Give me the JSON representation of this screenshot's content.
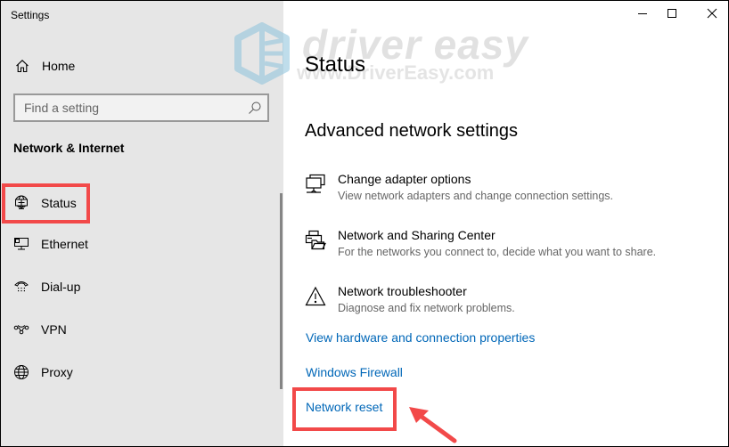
{
  "window": {
    "title": "Settings",
    "controls": {
      "minimize": "minimize-icon",
      "maximize": "maximize-icon",
      "close": "close-icon"
    }
  },
  "sidebar": {
    "home_label": "Home",
    "search": {
      "placeholder": "Find a setting",
      "value": ""
    },
    "section_heading": "Network & Internet",
    "items": [
      {
        "label": "Status",
        "icon": "globe-monitor-icon",
        "highlighted": true
      },
      {
        "label": "Ethernet",
        "icon": "ethernet-icon",
        "highlighted": false
      },
      {
        "label": "Dial-up",
        "icon": "dial-up-phone-icon",
        "highlighted": false
      },
      {
        "label": "VPN",
        "icon": "vpn-icon",
        "highlighted": false
      },
      {
        "label": "Proxy",
        "icon": "globe-icon",
        "highlighted": false
      }
    ]
  },
  "main": {
    "title": "Status",
    "subtitle": "Advanced network settings",
    "options": [
      {
        "title": "Change adapter options",
        "description": "View network adapters and change connection settings.",
        "icon": "network-adapter-icon"
      },
      {
        "title": "Network and Sharing Center",
        "description": "For the networks you connect to, decide what you want to share.",
        "icon": "sharing-center-icon"
      },
      {
        "title": "Network troubleshooter",
        "description": "Diagnose and fix network problems.",
        "icon": "warning-icon"
      }
    ],
    "links": [
      {
        "label": "View hardware and connection properties"
      },
      {
        "label": "Windows Firewall"
      },
      {
        "label": "Network reset",
        "highlighted": true
      }
    ]
  },
  "watermark": {
    "brand": "driver easy",
    "url": "www.DriverEasy.com"
  },
  "colors": {
    "accent_link": "#0067b8",
    "highlight": "#f24949",
    "sidebar_bg": "#e6e6e6",
    "watermark_logo": "#8cc3dc"
  }
}
